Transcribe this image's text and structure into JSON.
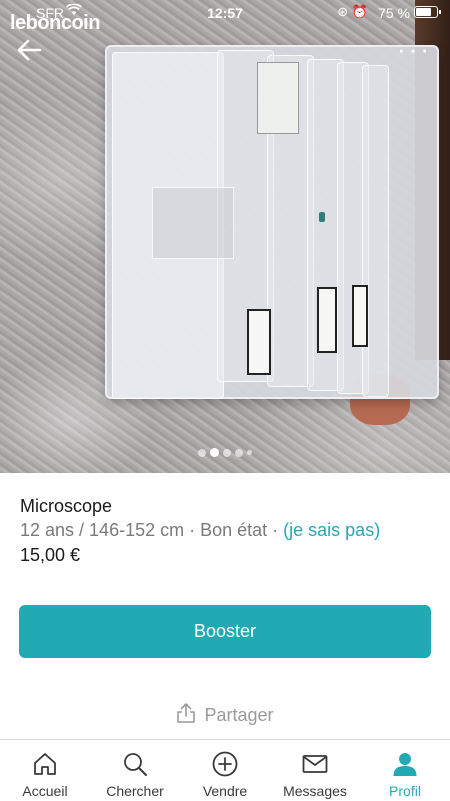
{
  "status_bar": {
    "carrier": "SFR",
    "time": "12:57",
    "battery_percent": "75 %",
    "battery_level": 0.75
  },
  "brand": {
    "logo_text": "leboncoin"
  },
  "gallery": {
    "photo_count": 5,
    "active_index": 1
  },
  "listing": {
    "title": "Microscope",
    "subtitle_main": "12 ans / 146-152 cm · Bon état · ",
    "subtitle_link": "(je sais pas)",
    "price": "15,00 €"
  },
  "actions": {
    "booster_label": "Booster",
    "share_label": "Partager"
  },
  "tabbar": {
    "items": [
      {
        "label": "Accueil",
        "icon": "home-icon"
      },
      {
        "label": "Chercher",
        "icon": "search-icon"
      },
      {
        "label": "Vendre",
        "icon": "plus-circle-icon"
      },
      {
        "label": "Messages",
        "icon": "mail-icon"
      },
      {
        "label": "Profil",
        "icon": "user-icon",
        "active": true
      }
    ]
  },
  "colors": {
    "accent": "#21aab4",
    "text": "#1a1a1a",
    "muted": "#7a7a7a"
  }
}
